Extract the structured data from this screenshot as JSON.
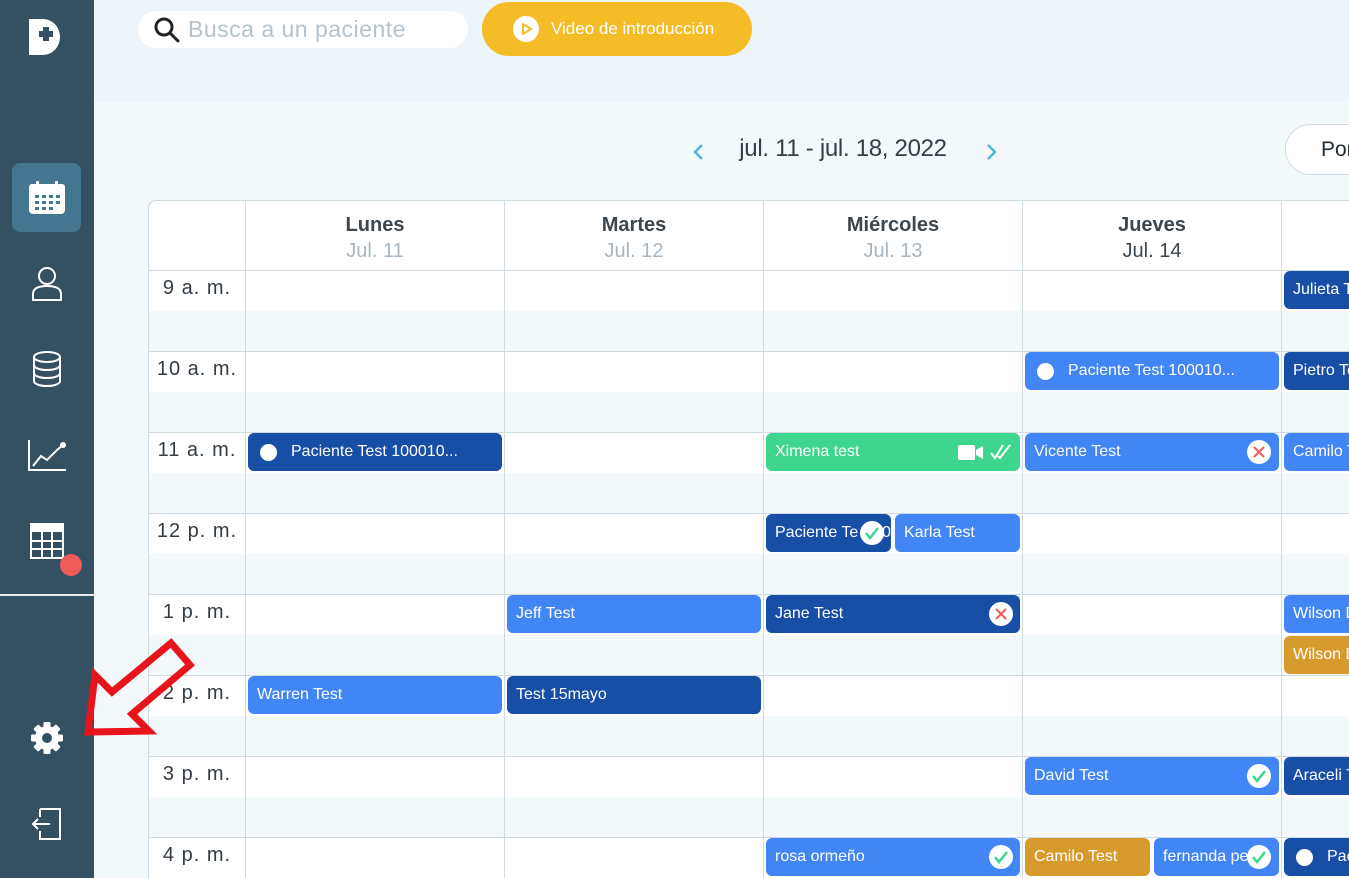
{
  "search": {
    "placeholder": "Busca a un paciente"
  },
  "video_button": {
    "label": "Video de introducción"
  },
  "week": {
    "range": "jul. 11 - jul. 18, 2022"
  },
  "view_button": {
    "label": "Por"
  },
  "days": [
    {
      "name": "Lunes",
      "date": "Jul. 11"
    },
    {
      "name": "Martes",
      "date": "Jul. 12"
    },
    {
      "name": "Miércoles",
      "date": "Jul. 13"
    },
    {
      "name": "Jueves",
      "date": "Jul. 14",
      "today": true
    }
  ],
  "hours": [
    "9 a. m.",
    "10 a. m.",
    "11 a. m.",
    "12 p. m.",
    "1 p. m.",
    "2 p. m.",
    "3 p. m.",
    "4 p. m."
  ],
  "events": {
    "mon_11": "Paciente Test 100010...",
    "mon_2": "Warren Test",
    "tue_1": "Jeff Test",
    "tue_2": "Test 15mayo",
    "wed_11": "Ximena test",
    "wed_12a": "Paciente Te",
    "wed_12a_suffix": "0",
    "wed_12b": "Karla Test",
    "wed_1": "Jane Test",
    "wed_4": "rosa ormeño",
    "thu_10": "Paciente Test 100010...",
    "thu_11": "Vicente Test",
    "thu_3": "David Test",
    "thu_4a": "Camilo Test",
    "thu_4b": "fernanda pe",
    "fri_9": "Julieta T",
    "fri_10": "Pietro Te",
    "fri_11": "Camilo T",
    "fri_1": "Wilson D",
    "fri_130": "Wilson D",
    "fri_3": "Araceli T",
    "fri_4": "Pac"
  },
  "colors": {
    "sidebar": "#345063",
    "event_dark": "#174ea6",
    "event_light": "#4285f4",
    "event_green": "#3ed68d",
    "event_gold": "#d69b2c",
    "accent_yellow": "#f4bd28",
    "annotation_red": "#e8141c"
  }
}
